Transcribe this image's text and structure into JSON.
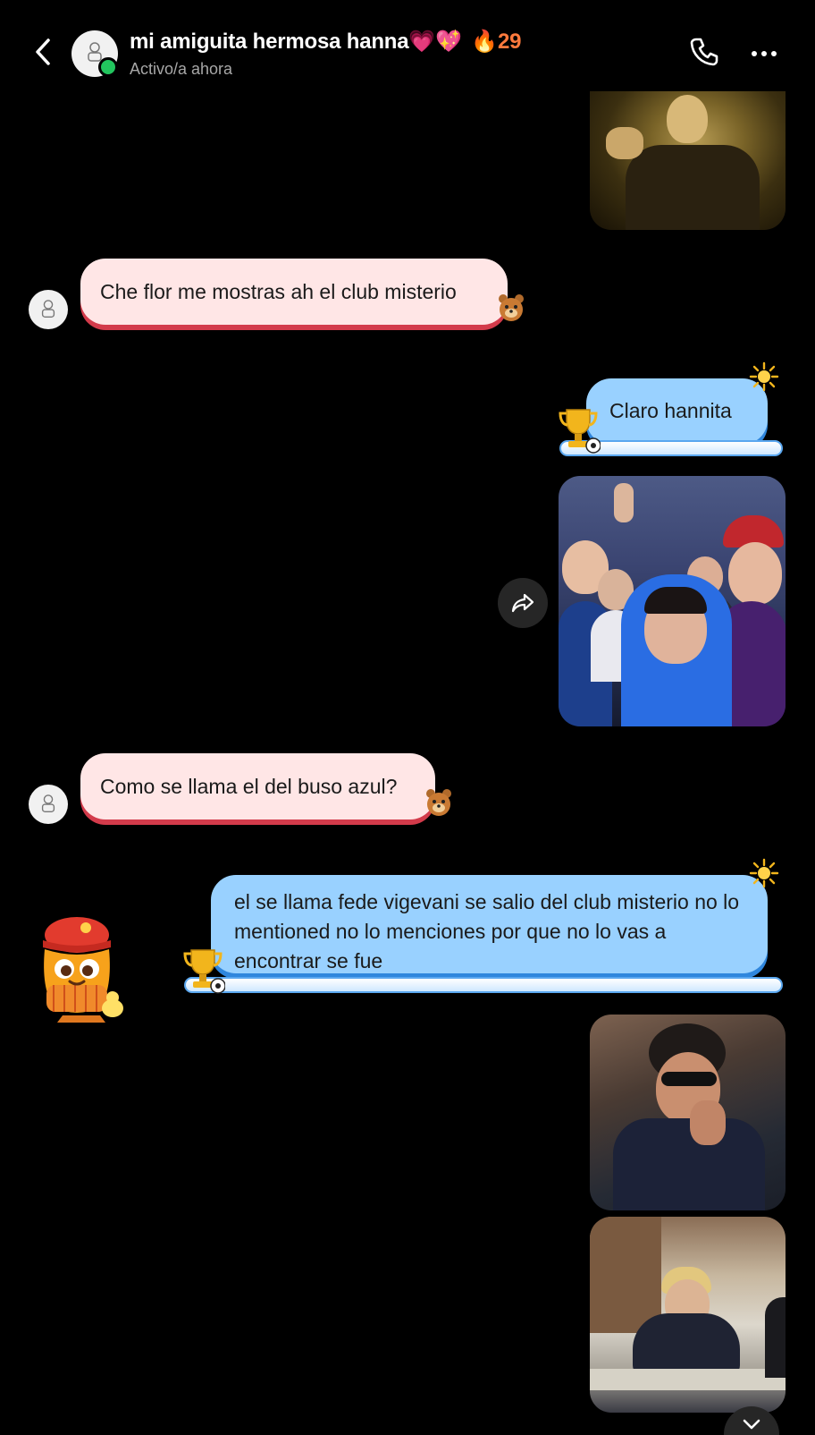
{
  "header": {
    "contact_name": "mi amiguita hermosa hanna💗💖",
    "streak_icon": "🔥",
    "streak_count": "29",
    "status": "Activo/a ahora",
    "online_color": "#22c55e"
  },
  "messages": [
    {
      "direction": "received",
      "kind": "text",
      "text": "Che flor me mostras ah el club misterio"
    },
    {
      "direction": "sent",
      "kind": "text",
      "text": "Claro hannita"
    },
    {
      "direction": "received",
      "kind": "text",
      "text": "Como se llama el del buso azul?"
    },
    {
      "direction": "sent",
      "kind": "text",
      "text": "el se llama fede vigevani se salio del club misterio no lo mentioned no lo menciones por que no lo vas a encontrar se fue"
    }
  ],
  "theme": {
    "received_bubble_fill": "#ffe6e6",
    "received_bubble_edge": "#d33b4b",
    "sent_bubble_fill": "#99d1ff",
    "sent_bubble_edge": "#2f86dd",
    "background": "#000000"
  }
}
